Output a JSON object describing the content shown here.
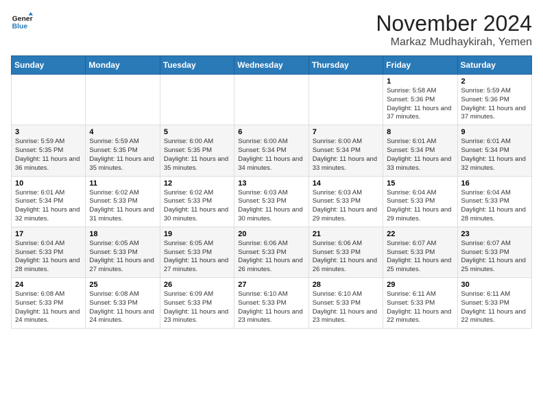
{
  "header": {
    "logo_line1": "General",
    "logo_line2": "Blue",
    "month": "November 2024",
    "location": "Markaz Mudhaykirah, Yemen"
  },
  "weekdays": [
    "Sunday",
    "Monday",
    "Tuesday",
    "Wednesday",
    "Thursday",
    "Friday",
    "Saturday"
  ],
  "weeks": [
    [
      {
        "day": "",
        "info": ""
      },
      {
        "day": "",
        "info": ""
      },
      {
        "day": "",
        "info": ""
      },
      {
        "day": "",
        "info": ""
      },
      {
        "day": "",
        "info": ""
      },
      {
        "day": "1",
        "info": "Sunrise: 5:58 AM\nSunset: 5:36 PM\nDaylight: 11 hours and 37 minutes."
      },
      {
        "day": "2",
        "info": "Sunrise: 5:59 AM\nSunset: 5:36 PM\nDaylight: 11 hours and 37 minutes."
      }
    ],
    [
      {
        "day": "3",
        "info": "Sunrise: 5:59 AM\nSunset: 5:35 PM\nDaylight: 11 hours and 36 minutes."
      },
      {
        "day": "4",
        "info": "Sunrise: 5:59 AM\nSunset: 5:35 PM\nDaylight: 11 hours and 35 minutes."
      },
      {
        "day": "5",
        "info": "Sunrise: 6:00 AM\nSunset: 5:35 PM\nDaylight: 11 hours and 35 minutes."
      },
      {
        "day": "6",
        "info": "Sunrise: 6:00 AM\nSunset: 5:34 PM\nDaylight: 11 hours and 34 minutes."
      },
      {
        "day": "7",
        "info": "Sunrise: 6:00 AM\nSunset: 5:34 PM\nDaylight: 11 hours and 33 minutes."
      },
      {
        "day": "8",
        "info": "Sunrise: 6:01 AM\nSunset: 5:34 PM\nDaylight: 11 hours and 33 minutes."
      },
      {
        "day": "9",
        "info": "Sunrise: 6:01 AM\nSunset: 5:34 PM\nDaylight: 11 hours and 32 minutes."
      }
    ],
    [
      {
        "day": "10",
        "info": "Sunrise: 6:01 AM\nSunset: 5:34 PM\nDaylight: 11 hours and 32 minutes."
      },
      {
        "day": "11",
        "info": "Sunrise: 6:02 AM\nSunset: 5:33 PM\nDaylight: 11 hours and 31 minutes."
      },
      {
        "day": "12",
        "info": "Sunrise: 6:02 AM\nSunset: 5:33 PM\nDaylight: 11 hours and 30 minutes."
      },
      {
        "day": "13",
        "info": "Sunrise: 6:03 AM\nSunset: 5:33 PM\nDaylight: 11 hours and 30 minutes."
      },
      {
        "day": "14",
        "info": "Sunrise: 6:03 AM\nSunset: 5:33 PM\nDaylight: 11 hours and 29 minutes."
      },
      {
        "day": "15",
        "info": "Sunrise: 6:04 AM\nSunset: 5:33 PM\nDaylight: 11 hours and 29 minutes."
      },
      {
        "day": "16",
        "info": "Sunrise: 6:04 AM\nSunset: 5:33 PM\nDaylight: 11 hours and 28 minutes."
      }
    ],
    [
      {
        "day": "17",
        "info": "Sunrise: 6:04 AM\nSunset: 5:33 PM\nDaylight: 11 hours and 28 minutes."
      },
      {
        "day": "18",
        "info": "Sunrise: 6:05 AM\nSunset: 5:33 PM\nDaylight: 11 hours and 27 minutes."
      },
      {
        "day": "19",
        "info": "Sunrise: 6:05 AM\nSunset: 5:33 PM\nDaylight: 11 hours and 27 minutes."
      },
      {
        "day": "20",
        "info": "Sunrise: 6:06 AM\nSunset: 5:33 PM\nDaylight: 11 hours and 26 minutes."
      },
      {
        "day": "21",
        "info": "Sunrise: 6:06 AM\nSunset: 5:33 PM\nDaylight: 11 hours and 26 minutes."
      },
      {
        "day": "22",
        "info": "Sunrise: 6:07 AM\nSunset: 5:33 PM\nDaylight: 11 hours and 25 minutes."
      },
      {
        "day": "23",
        "info": "Sunrise: 6:07 AM\nSunset: 5:33 PM\nDaylight: 11 hours and 25 minutes."
      }
    ],
    [
      {
        "day": "24",
        "info": "Sunrise: 6:08 AM\nSunset: 5:33 PM\nDaylight: 11 hours and 24 minutes."
      },
      {
        "day": "25",
        "info": "Sunrise: 6:08 AM\nSunset: 5:33 PM\nDaylight: 11 hours and 24 minutes."
      },
      {
        "day": "26",
        "info": "Sunrise: 6:09 AM\nSunset: 5:33 PM\nDaylight: 11 hours and 23 minutes."
      },
      {
        "day": "27",
        "info": "Sunrise: 6:10 AM\nSunset: 5:33 PM\nDaylight: 11 hours and 23 minutes."
      },
      {
        "day": "28",
        "info": "Sunrise: 6:10 AM\nSunset: 5:33 PM\nDaylight: 11 hours and 23 minutes."
      },
      {
        "day": "29",
        "info": "Sunrise: 6:11 AM\nSunset: 5:33 PM\nDaylight: 11 hours and 22 minutes."
      },
      {
        "day": "30",
        "info": "Sunrise: 6:11 AM\nSunset: 5:33 PM\nDaylight: 11 hours and 22 minutes."
      }
    ]
  ]
}
